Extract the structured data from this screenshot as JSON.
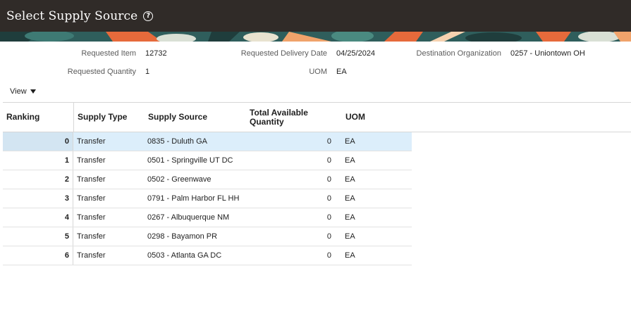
{
  "window": {
    "title": "Select Supply Source"
  },
  "header": {
    "requested_item_label": "Requested Item",
    "requested_item_value": "12732",
    "requested_delivery_date_label": "Requested Delivery Date",
    "requested_delivery_date_value": "04/25/2024",
    "destination_org_label": "Destination Organization",
    "destination_org_value": "0257 - Uniontown OH",
    "requested_quantity_label": "Requested Quantity",
    "requested_quantity_value": "1",
    "uom_label": "UOM",
    "uom_value": "EA"
  },
  "toolbar": {
    "view_label": "View",
    "view_icon": "caret-down-icon"
  },
  "table": {
    "columns": [
      "Ranking",
      "Supply Type",
      "Supply Source",
      "Total Available Quantity",
      "UOM"
    ],
    "selected_row": 0,
    "rows": [
      {
        "ranking": "0",
        "supply_type": "Transfer",
        "supply_source": "0835 - Duluth GA",
        "available": "0",
        "uom": "EA"
      },
      {
        "ranking": "1",
        "supply_type": "Transfer",
        "supply_source": "0501 - Springville UT DC",
        "available": "0",
        "uom": "EA"
      },
      {
        "ranking": "2",
        "supply_type": "Transfer",
        "supply_source": "0502 - Greenwave",
        "available": "0",
        "uom": "EA"
      },
      {
        "ranking": "3",
        "supply_type": "Transfer",
        "supply_source": "0791 - Palm Harbor FL HH",
        "available": "0",
        "uom": "EA"
      },
      {
        "ranking": "4",
        "supply_type": "Transfer",
        "supply_source": "0267 - Albuquerque NM",
        "available": "0",
        "uom": "EA"
      },
      {
        "ranking": "5",
        "supply_type": "Transfer",
        "supply_source": "0298 - Bayamon PR",
        "available": "0",
        "uom": "EA"
      },
      {
        "ranking": "6",
        "supply_type": "Transfer",
        "supply_source": "0503 - Atlanta GA DC",
        "available": "0",
        "uom": "EA"
      }
    ]
  },
  "colors": {
    "titlebar": "#302b28",
    "selected_row": "#dceefb",
    "banner_teal": "#2f5e5c",
    "banner_orange": "#e66a3b"
  }
}
